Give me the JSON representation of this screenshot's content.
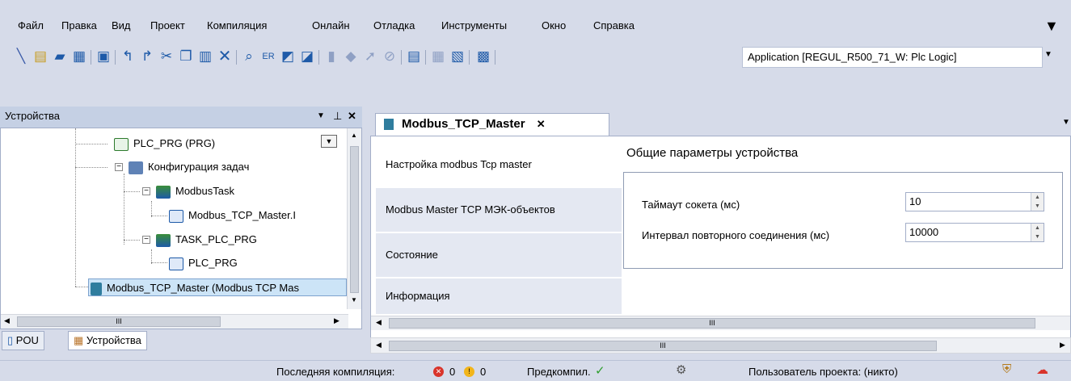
{
  "menu": [
    "Файл",
    "Правка",
    "Вид",
    "Проект",
    "Компиляция",
    "Онлайн",
    "Отладка",
    "Инструменты",
    "Окно",
    "Справка"
  ],
  "toolbar": {
    "icons": [
      "wand-icon",
      "new-file-icon",
      "open-folder-icon",
      "save-icon",
      "print-icon",
      "undo-icon",
      "redo-icon",
      "cut-icon",
      "copy-icon",
      "paste-icon",
      "delete-icon",
      "find-icon",
      "find-replace-icon",
      "toggle-bookmark-icon",
      "next-bookmark-icon",
      "breakpoint-icon",
      "step-over-icon",
      "step-into-icon",
      "disable-breakpoint-icon",
      "download-icon",
      "build-icon",
      "build-all-icon",
      "online-config-icon"
    ],
    "application": "Application [REGUL_R500_71_W: Plc Logic]"
  },
  "devices_panel": {
    "title": "Устройства",
    "tree": [
      {
        "label": "PLC_PRG (PRG)",
        "icon": "program-icon"
      },
      {
        "label": "Конфигурация задач",
        "icon": "task-config-icon"
      },
      {
        "label": "ModbusTask",
        "icon": "task-icon"
      },
      {
        "label": "Modbus_TCP_Master.I",
        "icon": "program-call-icon"
      },
      {
        "label": "TASK_PLC_PRG",
        "icon": "task-icon"
      },
      {
        "label": "PLC_PRG",
        "icon": "program-call-icon"
      },
      {
        "label": "Modbus_TCP_Master (Modbus TCP Mas",
        "icon": "modbus-device-icon"
      }
    ],
    "hscroll_label": "III",
    "tabs": [
      "POU",
      "Устройства"
    ]
  },
  "editor": {
    "tab_title": "Modbus_TCP_Master",
    "side_tabs": [
      "Настройка modbus Tcp master",
      "Modbus Master TCP МЭК-объектов",
      "Состояние",
      "Информация"
    ],
    "section_title": "Общие параметры устройства",
    "fields": [
      {
        "label": "Таймаут сокета (мс)",
        "value": "10"
      },
      {
        "label": "Интервал повторного соединения (мс)",
        "value": "10000"
      }
    ],
    "hscroll_label": "III"
  },
  "status": {
    "last_build": "Последняя компиляция:",
    "errors": "0",
    "warnings": "0",
    "precompile": "Предкомпил.",
    "user": "Пользователь проекта: (никто)"
  },
  "colors": {
    "accent": "#d6dbe9",
    "selection": "#cce4f7",
    "error": "#d9342b",
    "warning": "#f2b51a",
    "ok": "#2e9e2e"
  }
}
